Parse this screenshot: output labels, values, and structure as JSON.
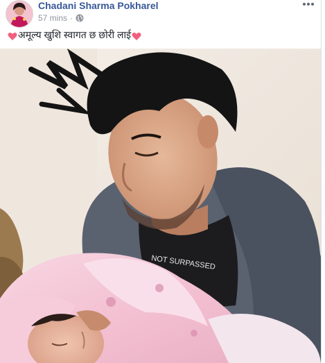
{
  "post": {
    "author": "Chadani Sharma Pokharel",
    "timestamp": "57 mins",
    "separator": "·",
    "privacy_icon": "globe-icon",
    "more_icon": "more-options-icon",
    "caption": "अमूल्य खुशि स्वागत छ छोरी लाई",
    "caption_emoji": "heart-icon",
    "photo": {
      "shirt_text": "NOT SURPASSED"
    }
  },
  "colors": {
    "author_link": "#385898",
    "meta_gray": "#90949c",
    "heart": "#f2607e"
  }
}
